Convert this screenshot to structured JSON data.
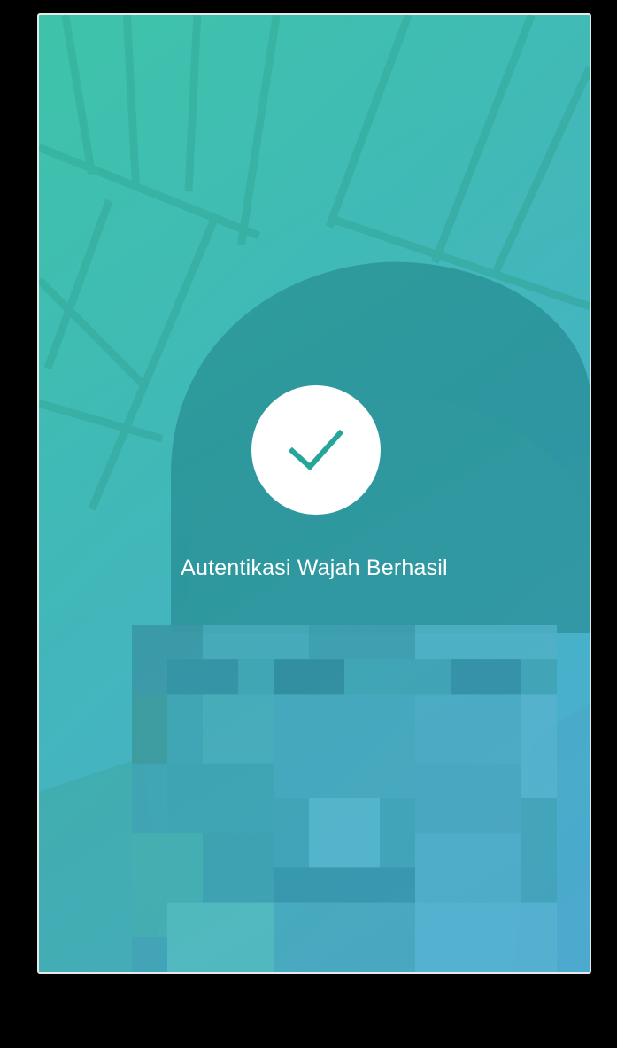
{
  "auth": {
    "status_text": "Autentikasi Wajah Berhasil",
    "check_icon": "check-icon"
  },
  "colors": {
    "accent_teal": "#26a69a",
    "overlay_start": "#3fc1aa",
    "overlay_end": "#4aaed0",
    "circle_bg": "#ffffff",
    "text": "#ffffff"
  }
}
